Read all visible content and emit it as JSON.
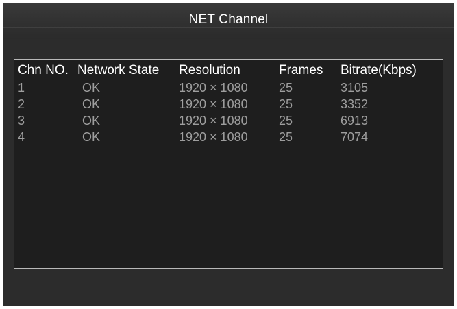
{
  "window": {
    "title": "NET Channel"
  },
  "table": {
    "headers": [
      "Chn NO.",
      "Network State",
      "Resolution",
      "Frames",
      "Bitrate(Kbps)"
    ],
    "rows": [
      [
        "1",
        "OK",
        "1920 × 1080",
        "25",
        "3105"
      ],
      [
        "2",
        "OK",
        "1920 × 1080",
        "25",
        "3352"
      ],
      [
        "3",
        "OK",
        "1920 × 1080",
        "25",
        "6913"
      ],
      [
        "4",
        "OK",
        "1920 × 1080",
        "25",
        "7074"
      ]
    ]
  },
  "colors": {
    "background": "#2c2c2c",
    "panel_background": "#1e1e1e",
    "panel_border": "#b9b9b9",
    "header_text": "#ffffff",
    "cell_text": "#9e9e9e"
  }
}
